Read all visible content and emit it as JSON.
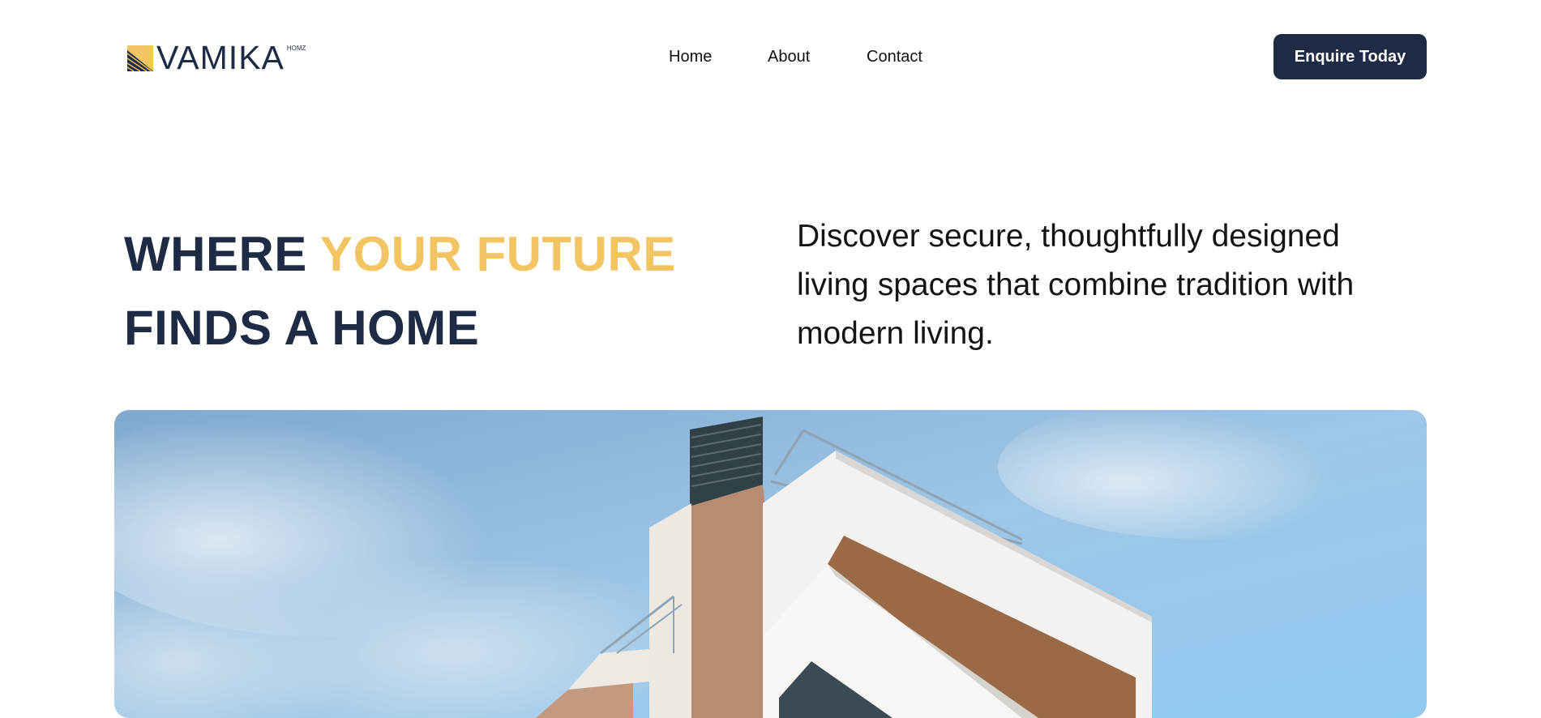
{
  "brand": {
    "name": "VAMIKA",
    "superscript": "HOMZ",
    "colors": {
      "navy": "#1f2a44",
      "gold": "#f2c462"
    }
  },
  "nav": {
    "items": [
      {
        "label": "Home"
      },
      {
        "label": "About"
      },
      {
        "label": "Contact"
      }
    ]
  },
  "cta": {
    "label": "Enquire Today"
  },
  "hero": {
    "title_part1": "WHERE ",
    "title_accent": "YOUR FUTURE",
    "title_part2": "FINDS A HOME",
    "description": "Discover secure, thoughtfully designed living spaces that combine tradition with modern living.",
    "image": {
      "subject": "modern-white-house-against-blue-sky"
    }
  }
}
